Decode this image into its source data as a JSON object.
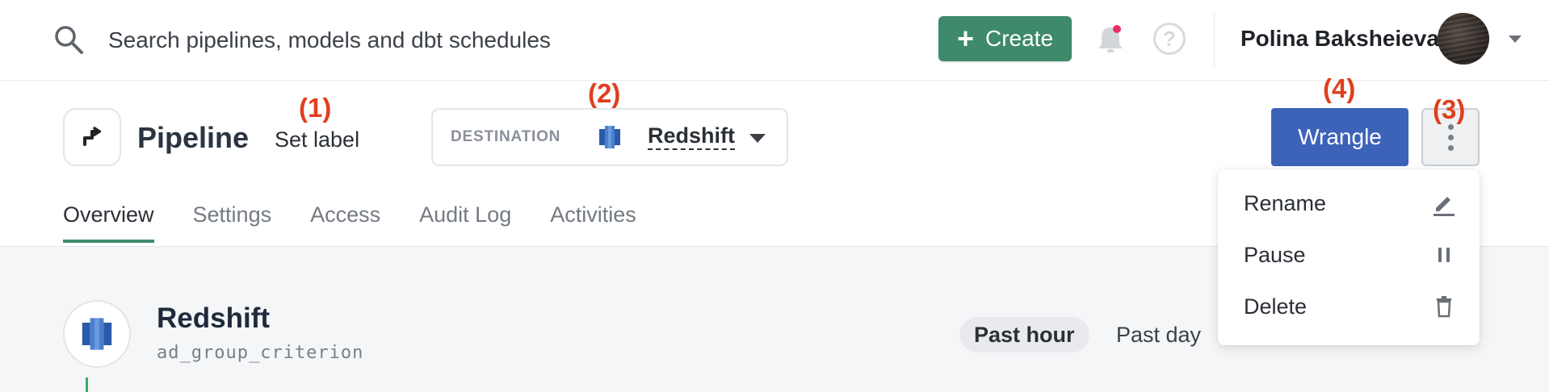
{
  "topbar": {
    "search_placeholder": "Search pipelines, models and dbt schedules",
    "create_label": "Create",
    "create_icon": "plus-icon",
    "help_glyph": "?",
    "user_name": "Polina Baksheieva",
    "notification_dot_color": "#e8316b"
  },
  "header": {
    "title": "Pipeline",
    "set_label": "Set label",
    "destination_label": "DESTINATION",
    "destination_value": "Redshift",
    "wrangle_label": "Wrangle"
  },
  "annotations": {
    "a1": "(1)",
    "a2": "(2)",
    "a3": "(3)",
    "a4": "(4)"
  },
  "tabs": [
    {
      "label": "Overview",
      "active": true
    },
    {
      "label": "Settings",
      "active": false
    },
    {
      "label": "Access",
      "active": false
    },
    {
      "label": "Audit Log",
      "active": false
    },
    {
      "label": "Activities",
      "active": false
    }
  ],
  "content": {
    "title": "Redshift",
    "subtitle": "ad_group_criterion",
    "range_active": "Past hour",
    "range_other": "Past day"
  },
  "menu": {
    "items": [
      {
        "label": "Rename",
        "icon": "pencil-icon"
      },
      {
        "label": "Pause",
        "icon": "pause-icon"
      },
      {
        "label": "Delete",
        "icon": "trash-icon"
      }
    ]
  },
  "colors": {
    "accent_green": "#3e8a6b",
    "wrangle_blue": "#3d63b8",
    "annotation_red": "#e03e1e"
  }
}
